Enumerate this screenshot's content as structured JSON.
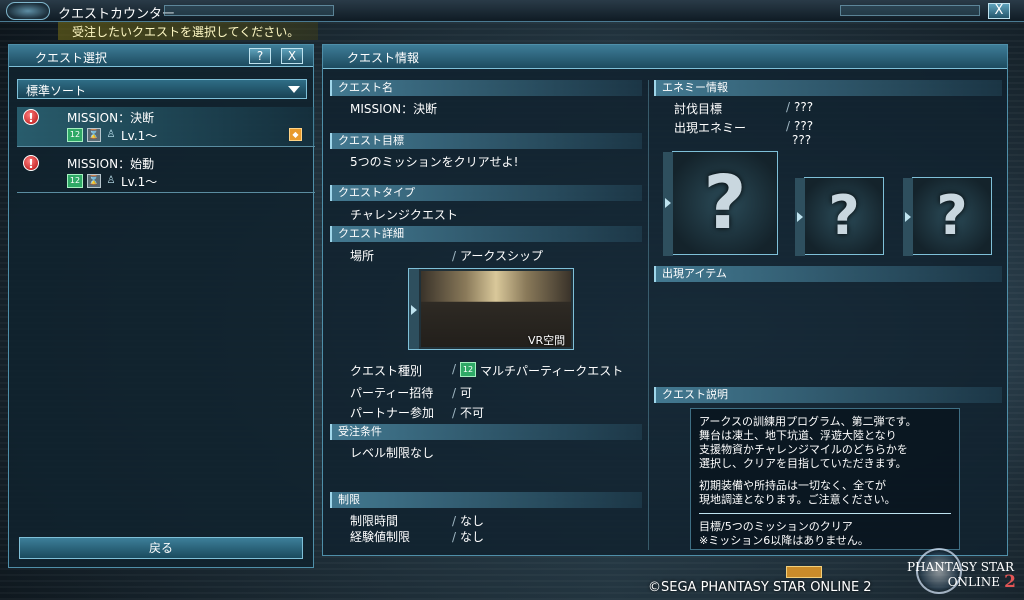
{
  "window": {
    "title": "クエストカウンター",
    "close_label": "X"
  },
  "instruction": "受注したいクエストを選択してください。",
  "left_panel": {
    "title": "クエスト選択",
    "help_label": "?",
    "close_label": "X",
    "sort": {
      "selected": "標準ソート"
    },
    "quests": [
      {
        "name": "MISSION：決断",
        "level": "Lv.1〜",
        "selected": true
      },
      {
        "name": "MISSION：始動",
        "level": "Lv.1〜",
        "selected": false
      }
    ],
    "back_label": "戻る"
  },
  "quest_info": {
    "title": "クエスト情報",
    "name_header": "クエスト名",
    "name": "MISSION：決断",
    "goal_header": "クエスト目標",
    "goal": "5つのミッションをクリアせよ!",
    "type_header": "クエストタイプ",
    "type": "チャレンジクエスト",
    "details_header": "クエスト詳細",
    "location_label": "場所",
    "location": "アークスシップ",
    "area_label": "VR空間",
    "kind_label": "クエスト種別",
    "kind": "マルチパーティークエスト",
    "party_invite_label": "パーティー招待",
    "party_invite": "可",
    "partner_label": "パートナー参加",
    "partner": "不可",
    "conditions_header": "受注条件",
    "conditions": "レベル制限なし",
    "limits_header": "制限",
    "time_limit_label": "制限時間",
    "time_limit": "なし",
    "exp_limit_label": "経験値制限",
    "exp_limit": "なし"
  },
  "enemy_info": {
    "header": "エネミー情報",
    "target_label": "討伐目標",
    "target": "???",
    "appear_label": "出現エネミー",
    "appear_1": "???",
    "appear_2": "???",
    "card_mark": "?"
  },
  "items": {
    "header": "出現アイテム"
  },
  "description": {
    "header": "クエスト説明",
    "lines": [
      "アークスの訓練用プログラム、第二弾です。",
      "舞台は凍土、地下坑道、浮遊大陸となり",
      "支援物資かチャレンジマイルのどちらかを",
      "選択し、クリアを目指していただきます。"
    ],
    "note_lines": [
      "初期装備や所持品は一切なく、全てが",
      "現地調達となります。ご注意ください。"
    ],
    "goal_lines": [
      "目標/5つのミッションのクリア",
      "※ミッション6以降はありません。"
    ]
  },
  "footer": {
    "copyright": "©SEGA PHANTASY STAR ONLINE 2",
    "logo_line1": "PHANTASY STAR",
    "logo_line2": "ONLINE",
    "logo_num": "2"
  },
  "colors": {
    "accent": "#3e7d98",
    "panel_bg": "#10222e",
    "highlight": "#7fc0d8"
  }
}
